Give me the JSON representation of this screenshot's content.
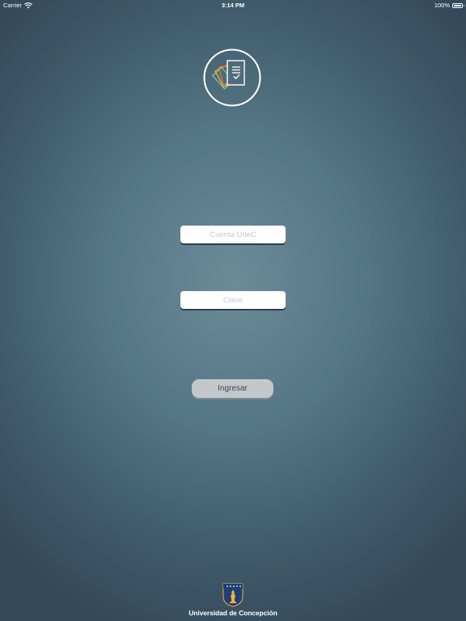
{
  "status_bar": {
    "carrier": "Carrier",
    "time": "3:14 PM",
    "battery": "100%"
  },
  "logo": {
    "icon": "documents-check-icon",
    "colors": [
      "#e8734a",
      "#f2b233",
      "#6fcf97",
      "#ffffff"
    ]
  },
  "login": {
    "user_placeholder": "Cuenta UdeC",
    "password_placeholder": "Clave",
    "submit_label": "Ingresar"
  },
  "footer": {
    "university_name": "Universidad de Concepción",
    "crest_icon": "university-crest-icon"
  },
  "colors": {
    "background_center": "#6c8b99",
    "background_edge": "#34495a",
    "button_background": "#c3c7cb",
    "button_text": "#3c4a55",
    "crest_blue": "#1f3f7a",
    "crest_gold": "#f2b233"
  }
}
